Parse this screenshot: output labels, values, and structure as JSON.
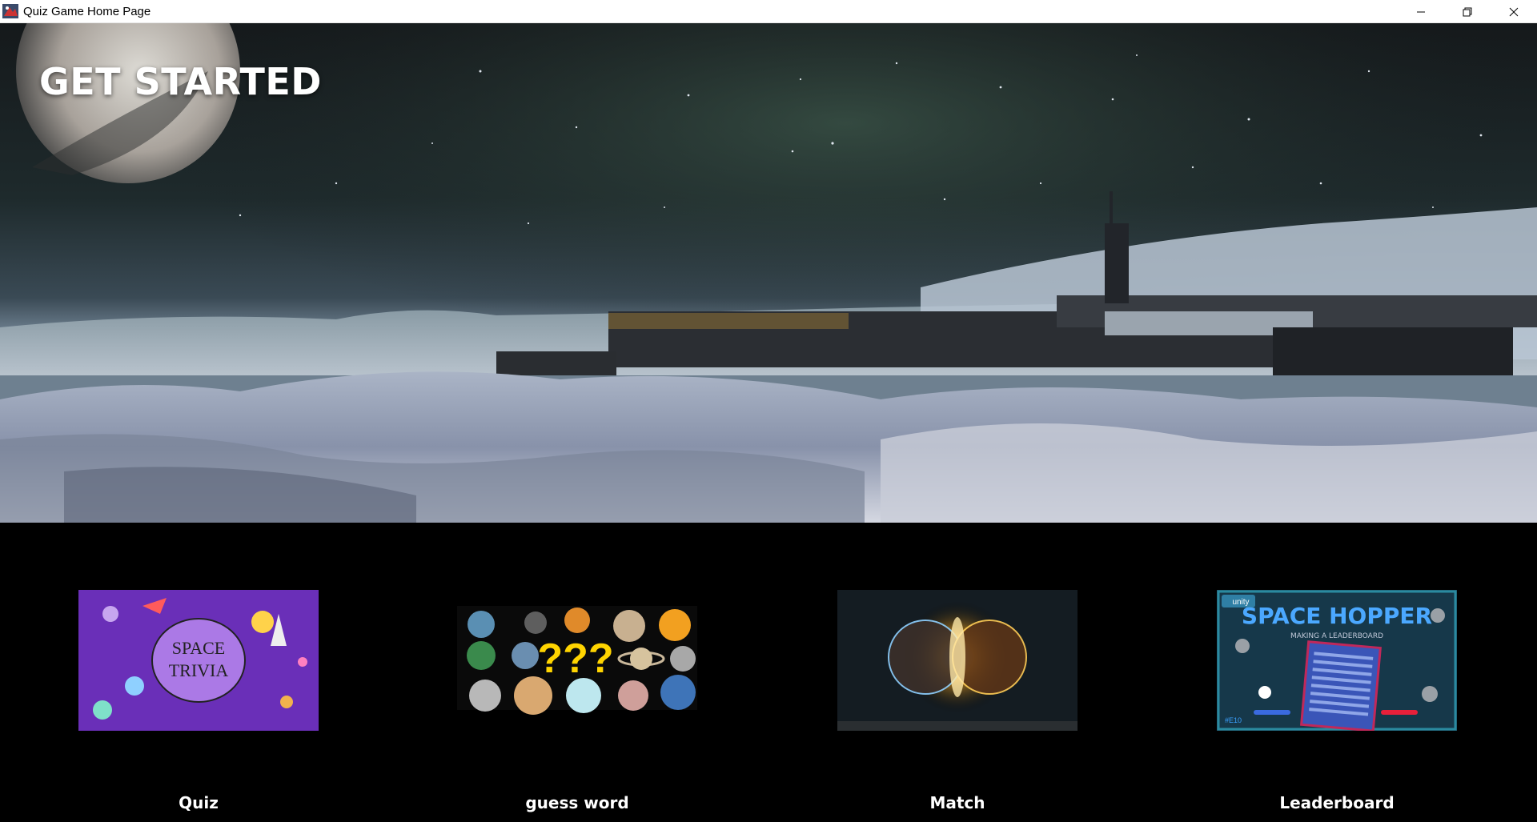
{
  "window": {
    "title": "Quiz Game Home Page",
    "controls": [
      "minimize-icon",
      "restore-icon",
      "close-icon"
    ]
  },
  "hero": {
    "heading": "GET STARTED"
  },
  "cards": [
    {
      "id": "quiz",
      "label": "Quiz",
      "thumb_text": [
        "SPACE",
        "TRIVIA"
      ]
    },
    {
      "id": "guess-word",
      "label": "guess word",
      "thumb_text": [
        "???"
      ]
    },
    {
      "id": "match",
      "label": "Match"
    },
    {
      "id": "leaderboard",
      "label": "Leaderboard",
      "thumb_text": [
        "SPACE HOPPER",
        "MAKING A LEADERBOARD",
        "unity",
        "#E10"
      ]
    }
  ],
  "colors": {
    "background": "#000000",
    "titlebar": "#ffffff",
    "text": "#ffffff"
  }
}
